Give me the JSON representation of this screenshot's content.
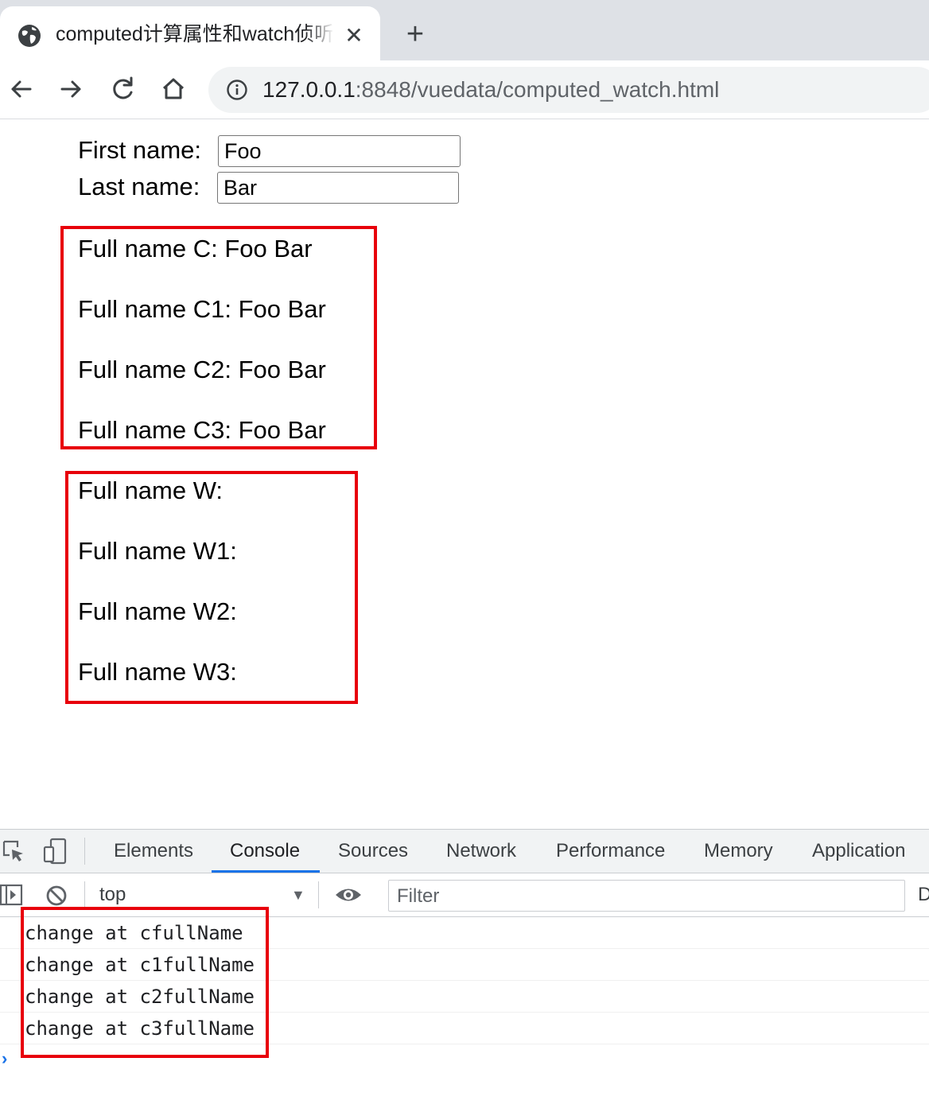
{
  "browser": {
    "tab": {
      "title": "computed计算属性和watch侦听",
      "favicon": "globe-icon",
      "close_glyph": "✕"
    },
    "new_tab_glyph": "+",
    "toolbar": {
      "back_icon": "back-arrow-icon",
      "forward_icon": "forward-arrow-icon",
      "reload_icon": "reload-icon",
      "home_icon": "home-icon",
      "security_icon": "info-icon"
    },
    "url": {
      "host": "127.0.0.1",
      "rest": ":8848/vuedata/computed_watch.html"
    }
  },
  "page": {
    "first_name": {
      "label": "First name:",
      "value": "Foo"
    },
    "last_name": {
      "label": "Last name:",
      "value": "Bar"
    },
    "computed_results": [
      "Full name C: Foo Bar",
      "Full name C1: Foo Bar",
      "Full name C2: Foo Bar",
      "Full name C3: Foo Bar"
    ],
    "watch_results": [
      "Full name W:",
      "Full name W1:",
      "Full name W2:",
      "Full name W3:"
    ],
    "highlight_color": "#e8000b"
  },
  "devtools": {
    "tabs": [
      "Elements",
      "Console",
      "Sources",
      "Network",
      "Performance",
      "Memory",
      "Application"
    ],
    "active_tab": "Console",
    "context": "top",
    "filter_placeholder": "Filter",
    "clipped_text": "D",
    "console_messages": [
      "change at cfullName",
      "change at c1fullName",
      "change at c2fullName",
      "change at c3fullName"
    ],
    "prompt_glyph": "›",
    "accent_color": "#1a73e8"
  }
}
